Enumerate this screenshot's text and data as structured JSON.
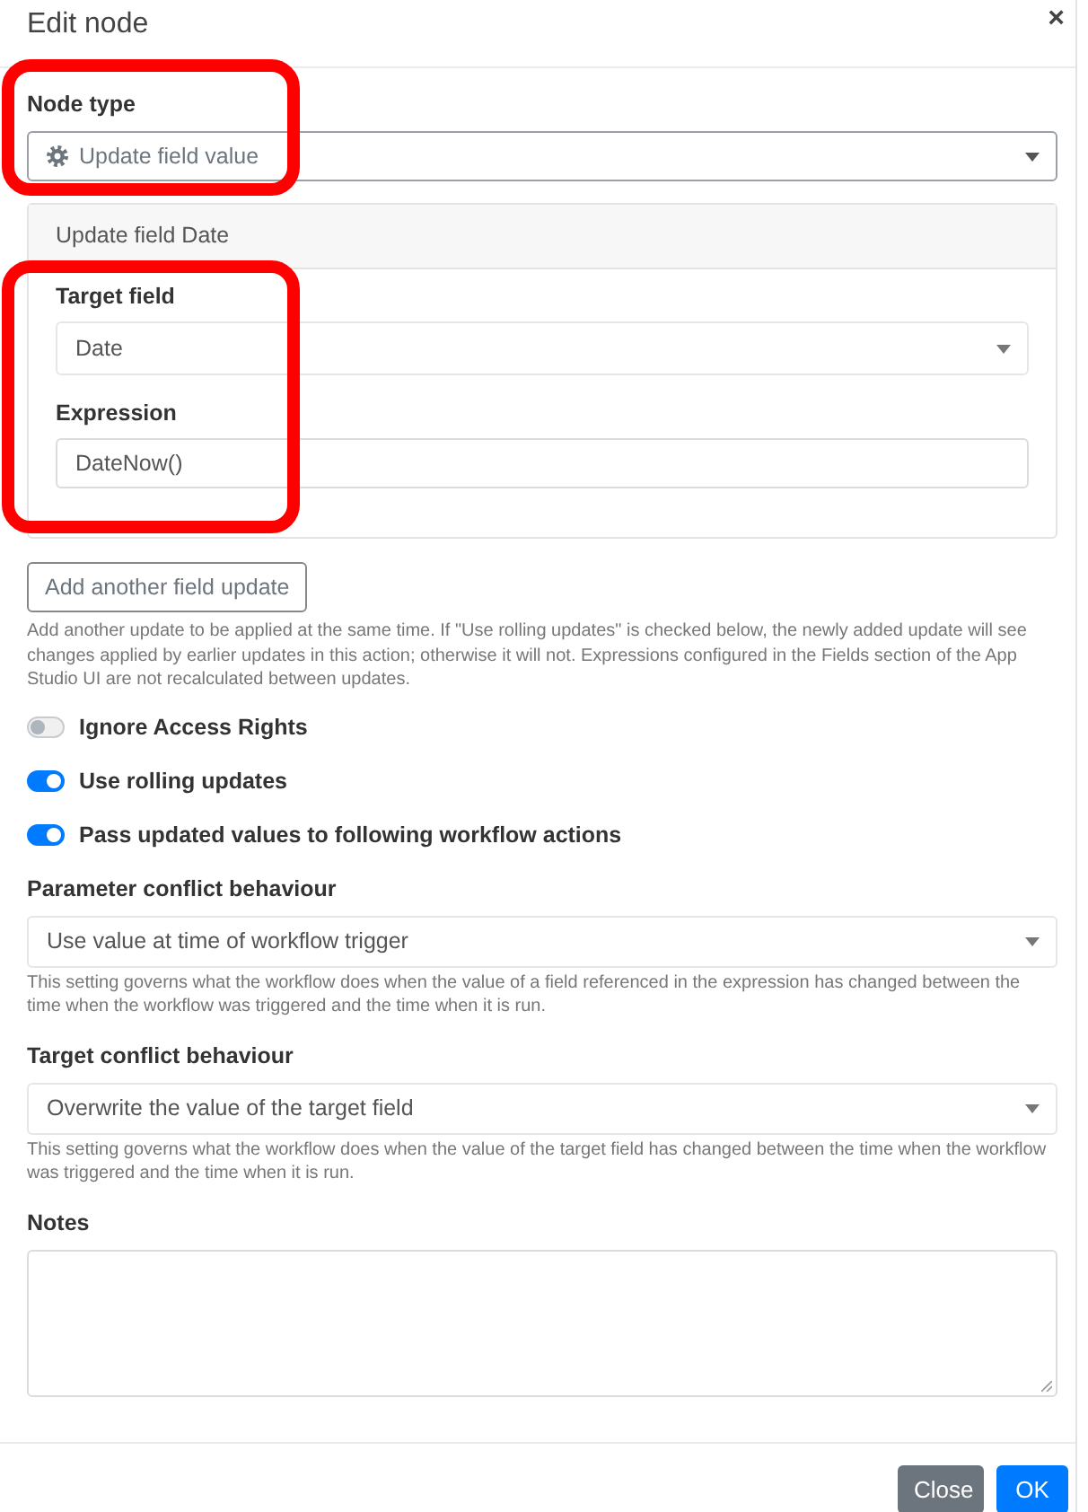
{
  "dialog": {
    "title": "Edit node",
    "close": "×"
  },
  "node_type": {
    "label": "Node type",
    "value": "Update field value"
  },
  "field_updates": [
    {
      "header": "Update field Date",
      "target_label": "Target field",
      "target_value": "Date",
      "expression_label": "Expression",
      "expression_value": "DateNow()"
    }
  ],
  "add_update": {
    "button": "Add another field update",
    "help": "Add another update to be applied at the same time. If \"Use rolling updates\" is checked below, the newly added update will see changes applied by earlier updates in this action; otherwise it will not. Expressions configured in the Fields section of the App Studio UI are not recalculated between updates."
  },
  "toggles": [
    {
      "label": "Ignore Access Rights",
      "on": false
    },
    {
      "label": "Use rolling updates",
      "on": true
    },
    {
      "label": "Pass updated values to following workflow actions",
      "on": true
    }
  ],
  "behaviours": [
    {
      "label": "Parameter conflict behaviour",
      "value": "Use value at time of workflow trigger",
      "help": "This setting governs what the workflow does when the value of a field referenced in the expression has changed between the time when the workflow was triggered and the time when it is run."
    },
    {
      "label": "Target conflict behaviour",
      "value": "Overwrite the value of the target field",
      "help": "This setting governs what the workflow does when the value of the target field has changed between the time when the workflow was triggered and the time when it is run."
    }
  ],
  "notes": {
    "label": "Notes"
  },
  "footer_buttons": [
    {
      "label": "Close",
      "kind": "secondary"
    },
    {
      "label": "OK",
      "kind": "primary"
    }
  ]
}
